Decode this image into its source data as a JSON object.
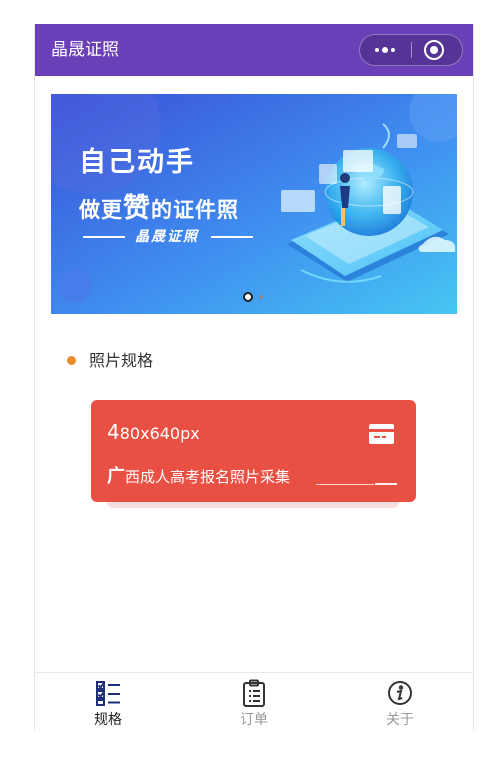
{
  "colors": {
    "nav_bg": "#6a3fb8",
    "accent_orange": "#f08a2a",
    "card_red": "#e85044",
    "tab_active": "#1f2f77",
    "tab_inactive": "#999999"
  },
  "navbar": {
    "title": "晶晟证照",
    "more_icon": "more-dots-icon",
    "close_icon": "target-circle-icon"
  },
  "banner": {
    "headline": "自己动手",
    "subline_pre": "做更",
    "subline_big": "赞",
    "subline_post": "的证件照",
    "brand": "晶晟证照",
    "slide_count": 2,
    "active_slide": 1
  },
  "section": {
    "title": "照片规格"
  },
  "spec_card": {
    "size_first": "4",
    "size_rest": "80x640px",
    "name_first": "广",
    "name_rest": "西成人高考报名照片采集",
    "icon": "card-icon"
  },
  "tabbar": {
    "tabs": [
      {
        "label": "规格",
        "icon": "checklist-icon",
        "active": true
      },
      {
        "label": "订单",
        "icon": "clipboard-icon",
        "active": false
      },
      {
        "label": "关于",
        "icon": "info-circle-icon",
        "active": false
      }
    ]
  }
}
